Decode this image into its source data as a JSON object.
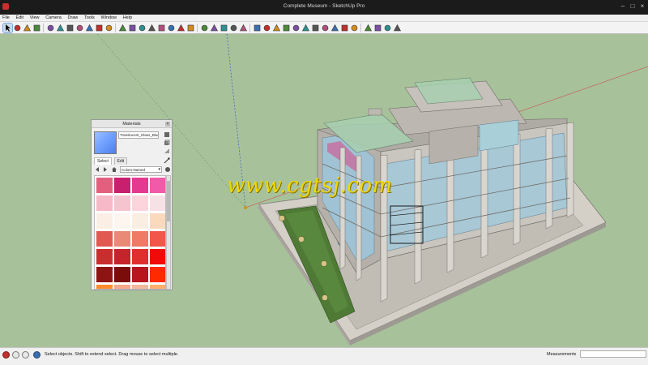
{
  "window": {
    "title": "Complete Museum - SketchUp Pro"
  },
  "menu": [
    "File",
    "Edit",
    "View",
    "Camera",
    "Draw",
    "Tools",
    "Window",
    "Help"
  ],
  "toolbar": {
    "tools": [
      "select-icon",
      "eraser-icon",
      "line-icon",
      "arc-icon",
      "shape-icon",
      "paint-bucket-icon",
      "push-pull-icon",
      "move-icon",
      "rotate-icon",
      "scale-icon",
      "offset-icon",
      "tape-measure-icon",
      "text-icon",
      "axes-icon",
      "protractor-icon",
      "orbit-icon",
      "pan-icon",
      "zoom-icon",
      "zoom-extents-icon",
      "warehouse-icon",
      "extension-icon",
      "layout-icon",
      "section-icon",
      "iso-view-icon",
      "top-view-icon",
      "front-view-icon",
      "right-view-icon",
      "back-view-icon",
      "left-view-icon",
      "xray-icon",
      "wireframe-icon",
      "hidden-line-icon",
      "shaded-icon",
      "textured-icon",
      "monochrome-icon",
      "position-camera-icon",
      "walk-icon",
      "look-around-icon",
      "sandbox-icon"
    ]
  },
  "materials": {
    "title": "Materials",
    "current_name": "Translucent_Glass_Blue",
    "tabs": [
      "Select",
      "Edit"
    ],
    "library": "Colors-Named",
    "swatches": [
      "#e2607e",
      "#c81f6e",
      "#e3398f",
      "#f05aa8",
      "#f7b9c7",
      "#f5c4cf",
      "#fbd4dc",
      "#f6e2e6",
      "#fbeee5",
      "#fdf6f0",
      "#faeee2",
      "#fbd9bd",
      "#e05a52",
      "#e88a76",
      "#f07a64",
      "#f2564b",
      "#c92e2e",
      "#c4242a",
      "#e0302e",
      "#f00a0a",
      "#8e1414",
      "#7a0c0c",
      "#b8161c",
      "#ff2a00",
      "#ff8c2a",
      "#f7a78a",
      "#f3b79a",
      "#ffb06a"
    ]
  },
  "watermark": "www.cgtsj.com",
  "status": {
    "hint": "Select objects. Shift to extend select. Drag mouse to select multiple.",
    "measurements_label": "Measurements",
    "measurements_value": ""
  },
  "colors": {
    "sky_ground": "#a7c29a",
    "glass": "#9fc2d4",
    "concrete": "#c9c5bf",
    "lawn": "#4f7a35"
  }
}
